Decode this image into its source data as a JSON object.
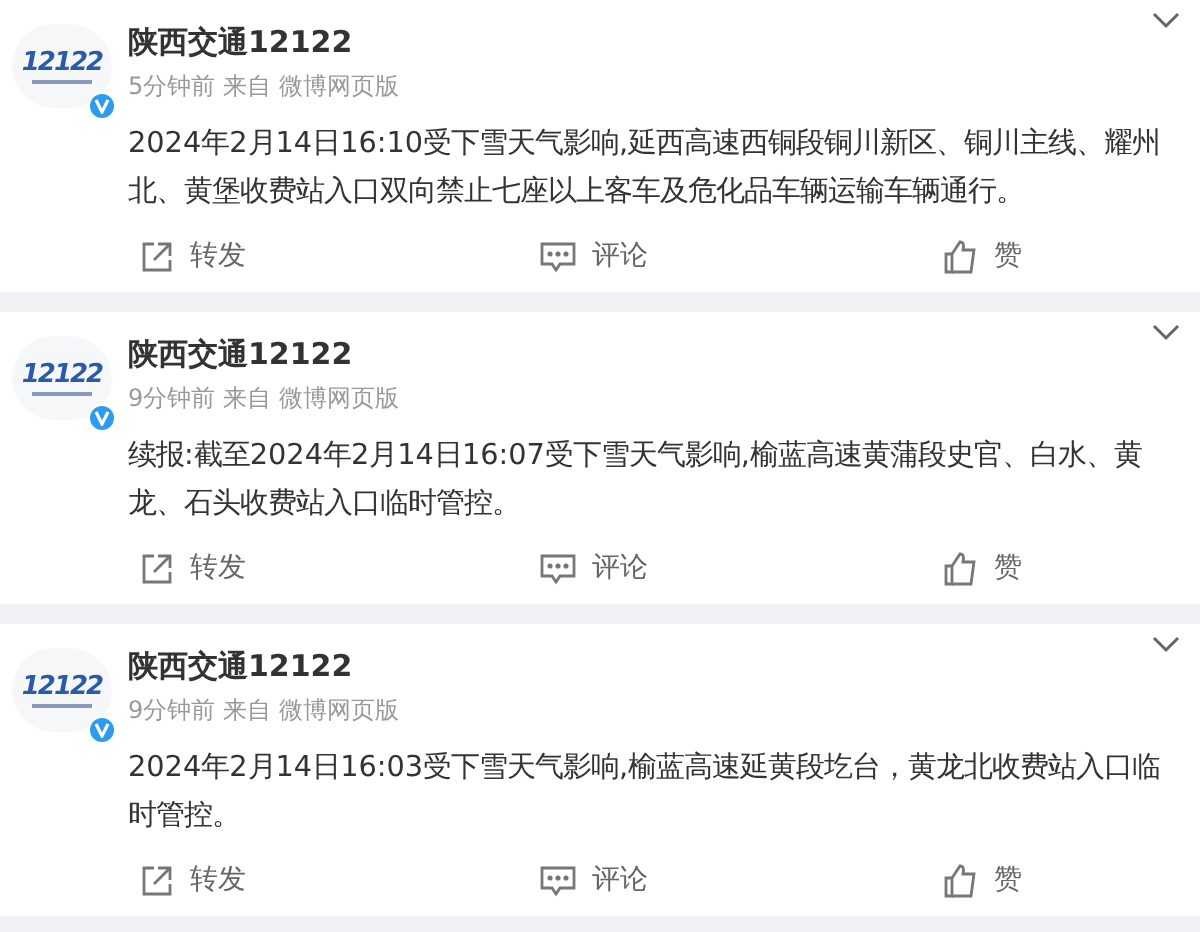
{
  "posts": [
    {
      "avatar_text": "12122",
      "verified": true,
      "author": "陕西交通12122",
      "time": "5分钟前",
      "source_label": "来自",
      "source": "微博网页版",
      "text": "2024年2月14日16:10受下雪天气影响,延西高速西铜段铜川新区、铜川主线、耀州北、黄堡收费站入口双向禁止七座以上客车及危化品车辆运输车辆通行。",
      "actions": [
        "转发",
        "评论",
        "赞"
      ]
    },
    {
      "avatar_text": "12122",
      "verified": true,
      "author": "陕西交通12122",
      "time": "9分钟前",
      "source_label": "来自",
      "source": "微博网页版",
      "text": "续报:截至2024年2月14日16:07受下雪天气影响,榆蓝高速黄蒲段史官、白水、黄龙、石头收费站入口临时管控。",
      "actions": [
        "转发",
        "评论",
        "赞"
      ]
    },
    {
      "avatar_text": "12122",
      "verified": true,
      "author": "陕西交通12122",
      "time": "9分钟前",
      "source_label": "来自",
      "source": "微博网页版",
      "text": "2024年2月14日16:03受下雪天气影响,榆蓝高速延黄段圪台，黄龙北收费站入口临时管控。",
      "actions": [
        "转发",
        "评论",
        "赞"
      ]
    }
  ]
}
